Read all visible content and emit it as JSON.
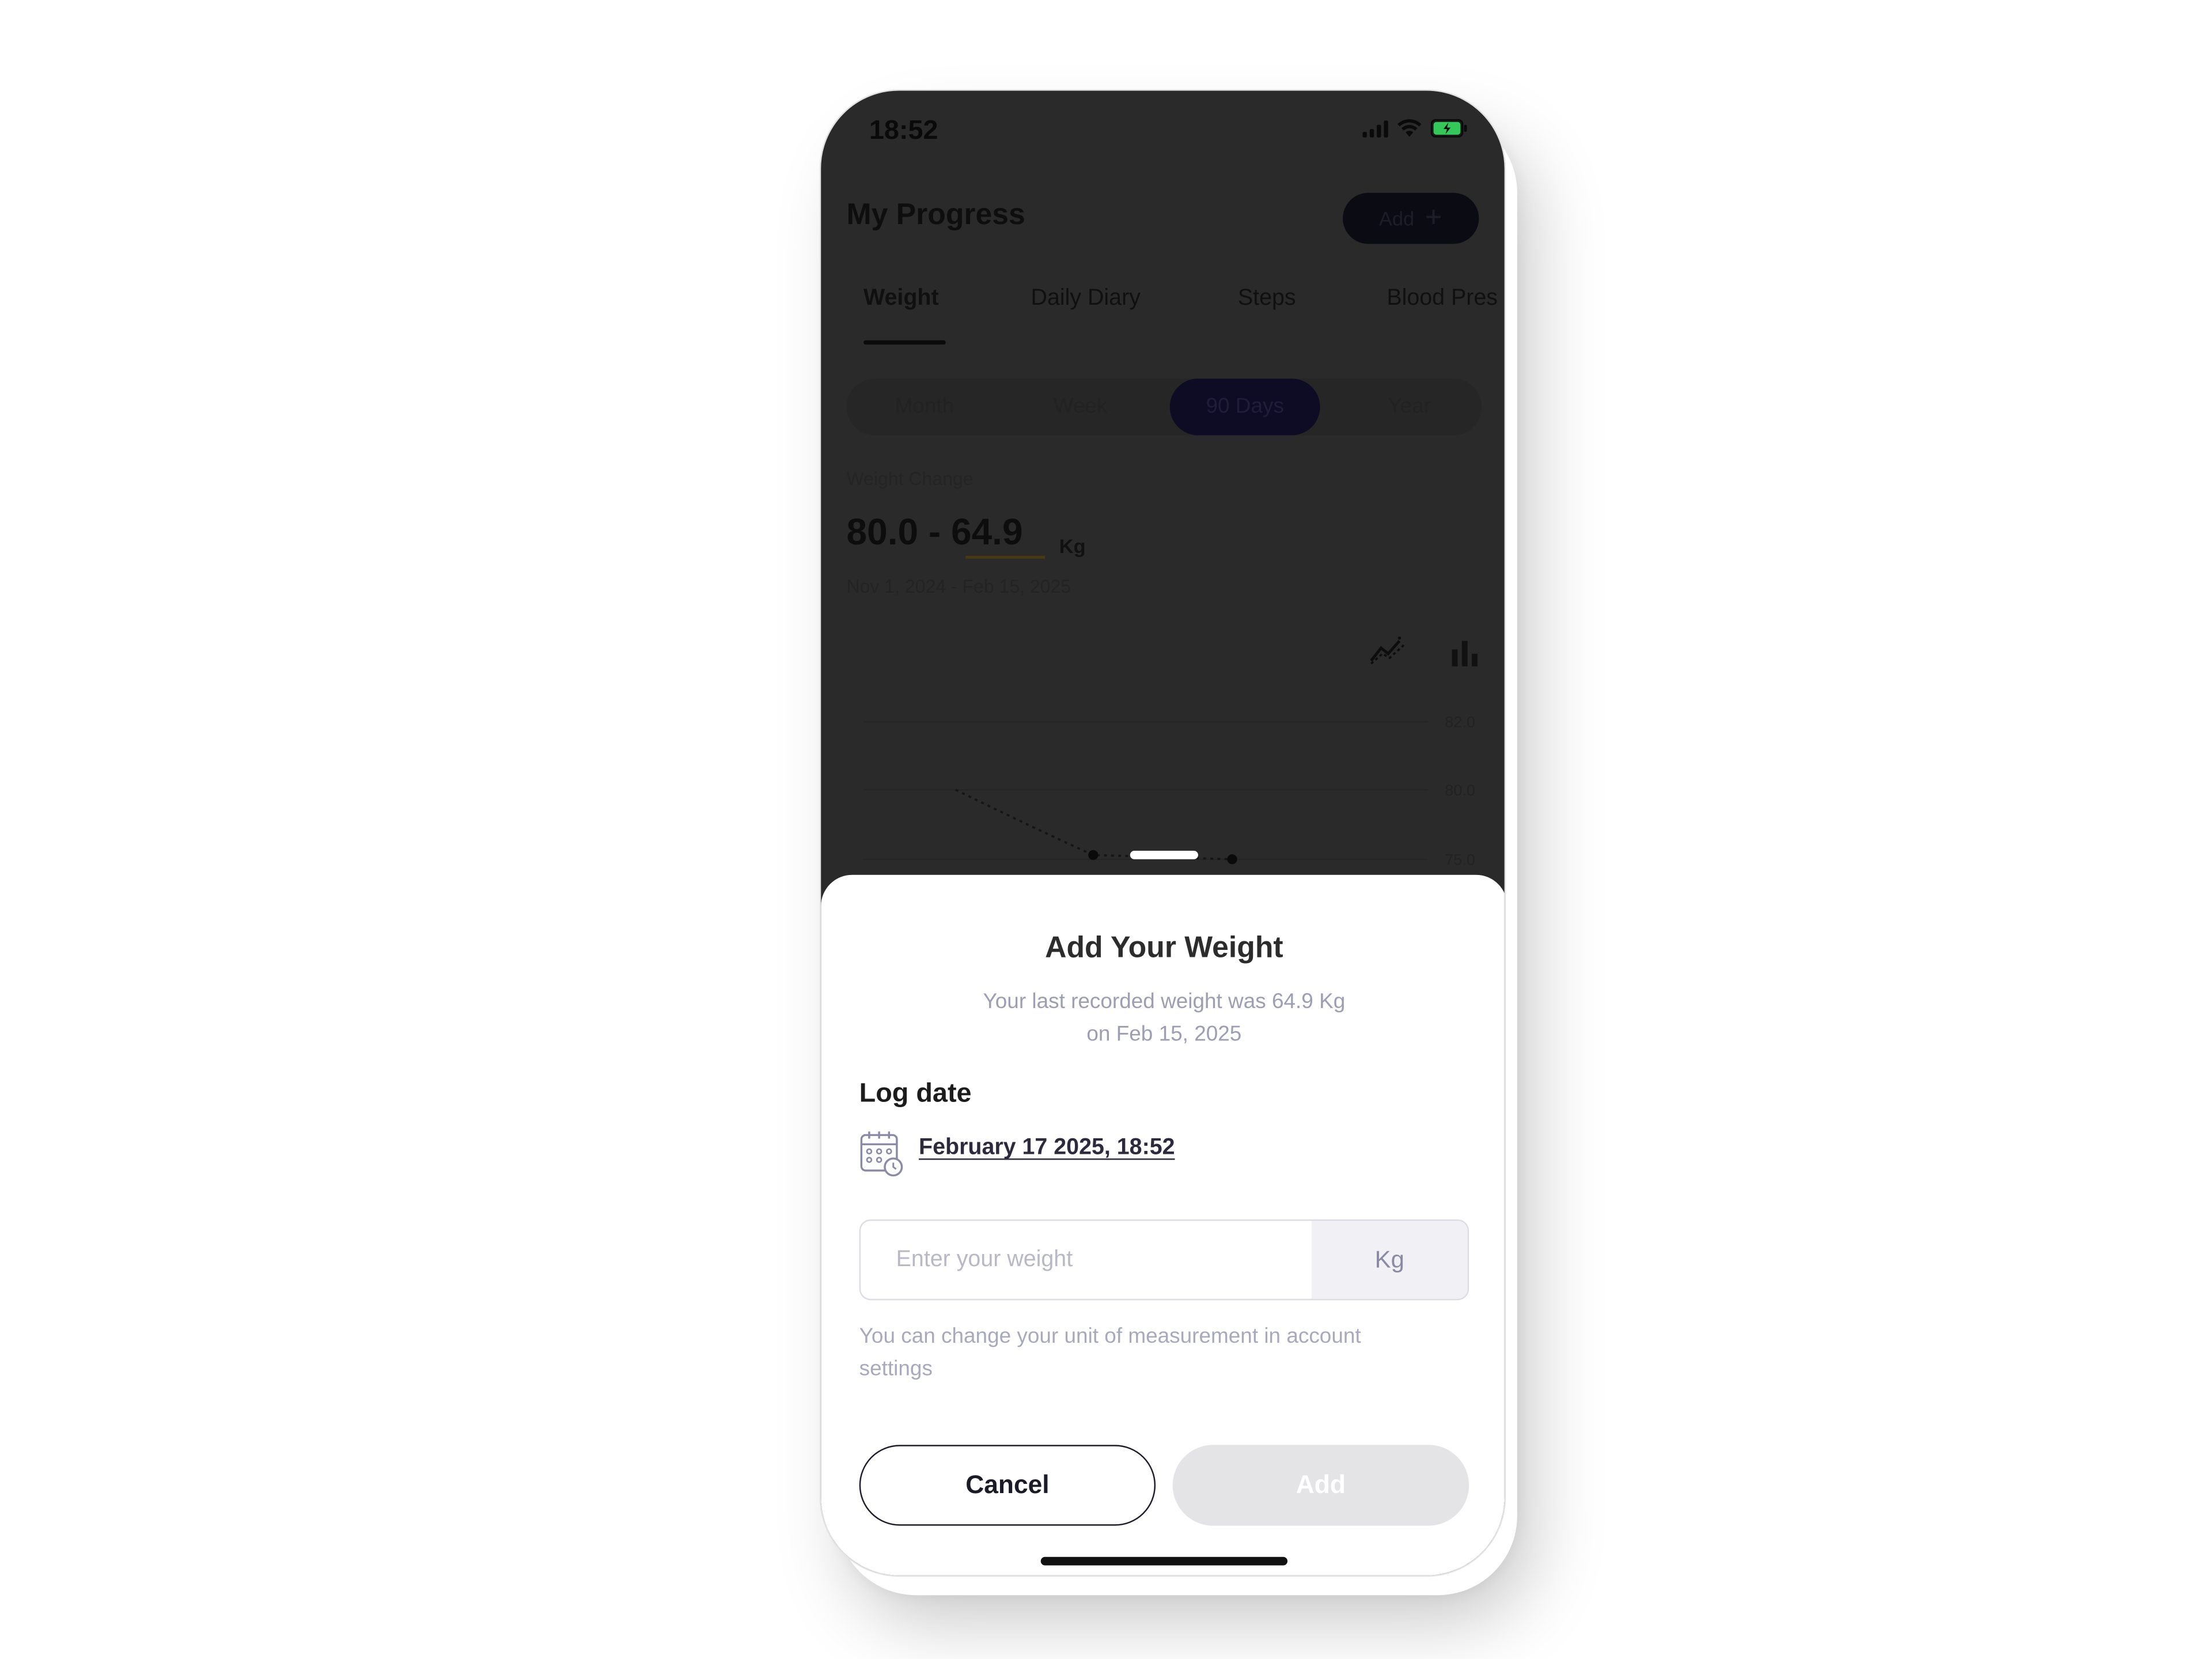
{
  "status_bar": {
    "time": "18:52",
    "battery_color": "#34c759"
  },
  "header": {
    "title": "My Progress",
    "add_label": "Add",
    "add_icon": "plus-icon"
  },
  "tabs": [
    {
      "label": "Weight",
      "active": true
    },
    {
      "label": "Daily Diary",
      "active": false
    },
    {
      "label": "Steps",
      "active": false
    },
    {
      "label": "Blood Pres",
      "active": false
    }
  ],
  "range_pills": [
    {
      "label": "Month",
      "active": false
    },
    {
      "label": "Week",
      "active": false
    },
    {
      "label": "90 Days",
      "active": true
    },
    {
      "label": "Year",
      "active": false
    }
  ],
  "summary": {
    "label": "Weight Change",
    "start_weight": "80.0",
    "separator": " - ",
    "end_weight": "64.9",
    "unit": "Kg",
    "date_range": "Nov 1, 2024 - Feb 15, 2025"
  },
  "chart_icons": [
    "line-chart-icon",
    "bar-chart-icon"
  ],
  "background_chart": {
    "y_ticks": [
      "82.0",
      "80.0",
      "75.0"
    ]
  },
  "sheet": {
    "title": "Add Your Weight",
    "subtitle_line1": "Your last recorded weight was 64.9 Kg",
    "subtitle_line2": "on Feb 15, 2025",
    "log_date_label": "Log date",
    "log_date_value": "February 17 2025, 18:52",
    "weight_placeholder": "Enter your weight",
    "weight_value": "",
    "unit": "Kg",
    "unit_hint": "You can change your unit of measurement in account settings",
    "cancel_label": "Cancel",
    "add_label": "Add",
    "add_enabled": false
  },
  "colors": {
    "overlay": "#2a2a2a",
    "accent_dark": "#1b1b28",
    "muted_text": "#a9a9bd",
    "disabled_button": "#e4e4e6"
  }
}
